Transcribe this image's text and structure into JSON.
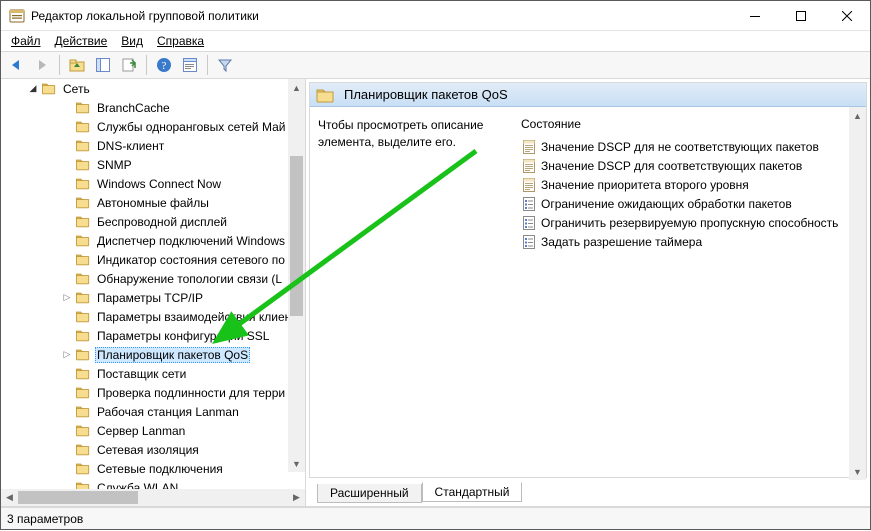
{
  "window": {
    "title": "Редактор локальной групповой политики"
  },
  "menu": {
    "file": "Файл",
    "action": "Действие",
    "view": "Вид",
    "help": "Справка"
  },
  "tree": {
    "root": "Сеть",
    "items": [
      "BranchCache",
      "Службы одноранговых сетей Май",
      "DNS-клиент",
      "SNMP",
      "Windows Connect Now",
      "Автономные файлы",
      "Беспроводной дисплей",
      "Диспетчер подключений Windows",
      "Индикатор состояния сетевого по",
      "Обнаружение топологии связи (L",
      "Параметры TCP/IP",
      "Параметры взаимодействия клиен",
      "Параметры конфигурации SSL",
      "Планировщик пакетов QoS",
      "Поставщик сети",
      "Проверка подлинности для терри",
      "Рабочая станция Lanman",
      "Сервер Lanman",
      "Сетевая изоляция",
      "Сетевые подключения",
      "Служба WLAN"
    ],
    "selected_index": 13,
    "expandable_indexes": [
      10,
      13
    ]
  },
  "right": {
    "title": "Планировщик пакетов QoS",
    "hint": "Чтобы просмотреть описание элемента, выделите его.",
    "column": "Состояние",
    "settings": [
      {
        "icon": "doc",
        "label": "Значение DSCP для не соответствующих пакетов"
      },
      {
        "icon": "doc",
        "label": "Значение DSCP для соответствующих пакетов"
      },
      {
        "icon": "doc",
        "label": "Значение приоритета второго уровня"
      },
      {
        "icon": "list",
        "label": "Ограничение ожидающих обработки пакетов"
      },
      {
        "icon": "list",
        "label": "Ограничить резервируемую пропускную способность"
      },
      {
        "icon": "list",
        "label": "Задать разрешение таймера"
      }
    ]
  },
  "tabs": {
    "extended": "Расширенный",
    "standard": "Стандартный"
  },
  "status": {
    "text": "3 параметров"
  }
}
